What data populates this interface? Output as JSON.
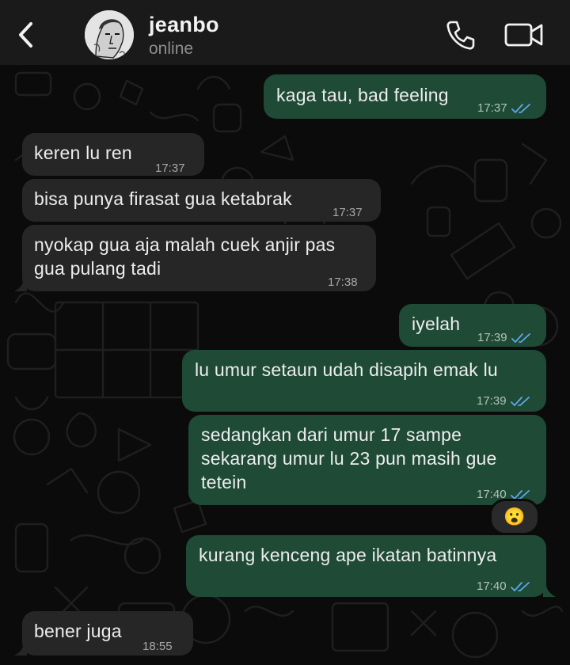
{
  "header": {
    "contact_name": "jeanbo",
    "status": "online"
  },
  "colors": {
    "outgoing_bubble": "#1e4a36",
    "incoming_bubble": "#262626",
    "read_ticks": "#5fa8e8",
    "header_bg": "#1a1a1a"
  },
  "messages": [
    {
      "dir": "out",
      "text": "kaga tau, bad feeling",
      "time": "17:37",
      "status": "read"
    },
    {
      "dir": "in",
      "text": "keren lu ren",
      "time": "17:37"
    },
    {
      "dir": "in",
      "text": "bisa punya firasat gua ketabrak",
      "time": "17:37"
    },
    {
      "dir": "in",
      "text": "nyokap gua aja malah cuek anjir pas\ngua pulang tadi",
      "time": "17:38"
    },
    {
      "dir": "out",
      "text": "iyelah",
      "time": "17:39",
      "status": "read"
    },
    {
      "dir": "out",
      "text": "lu umur setaun udah disapih emak lu",
      "time": "17:39",
      "status": "read"
    },
    {
      "dir": "out",
      "text": "sedangkan dari umur 17 sampe\nsekarang umur lu 23 pun masih gue\ntetein",
      "time": "17:40",
      "status": "read",
      "reaction": "😮"
    },
    {
      "dir": "out",
      "text": "kurang kenceng ape ikatan batinnya",
      "time": "17:40",
      "status": "read"
    },
    {
      "dir": "in",
      "text": "bener juga",
      "time": "18:55"
    }
  ]
}
